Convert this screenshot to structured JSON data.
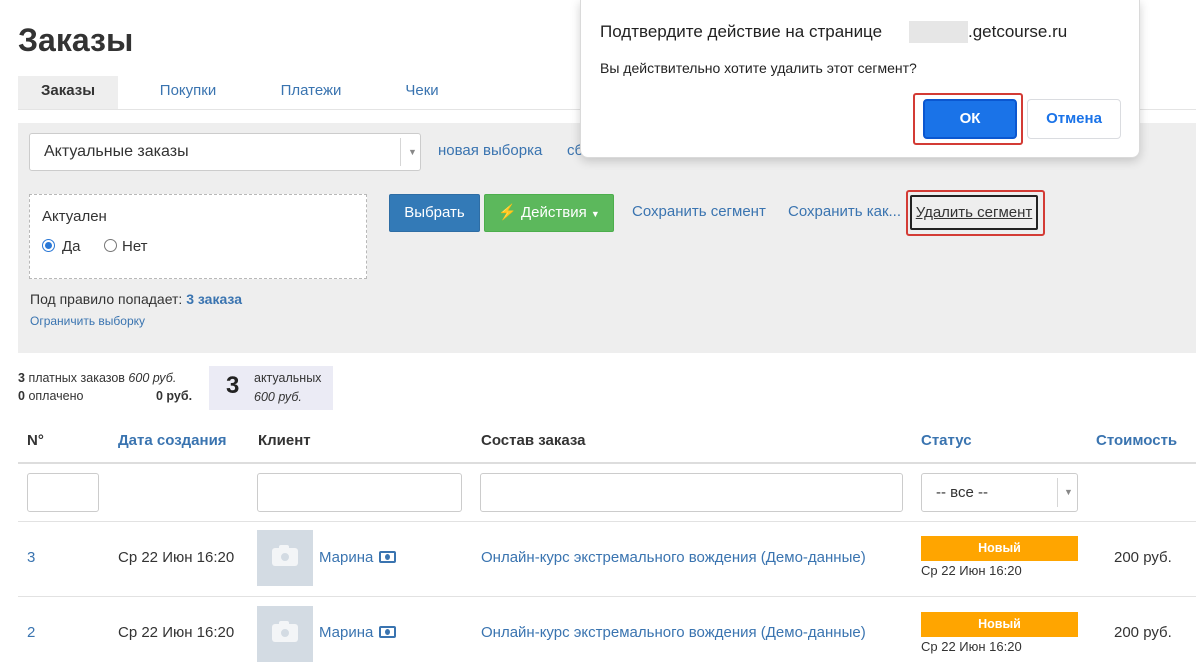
{
  "page": {
    "title": "Заказы"
  },
  "tabs": [
    {
      "label": "Заказы",
      "active": true
    },
    {
      "label": "Покупки"
    },
    {
      "label": "Платежи"
    },
    {
      "label": "Чеки"
    }
  ],
  "filter": {
    "segment_select": "Актуальные заказы",
    "new_selection_link": "новая выборка",
    "truncated_link": "сб",
    "segment_title": "Актуален",
    "radio_yes": "Да",
    "radio_no": "Нет",
    "radio_selected": "Да",
    "select_button": "Выбрать",
    "actions_button": "Действия",
    "save_segment": "Сохранить сегмент",
    "save_as": "Сохранить как...",
    "delete_segment": "Удалить сегмент",
    "rule_prefix": "Под правило попадает:",
    "rule_count": "3 заказа",
    "limit_link": "Ограничить выборку"
  },
  "stats": {
    "paid_count": "3",
    "paid_label": "платных заказов",
    "paid_sum": "600 руб.",
    "payed_count": "0",
    "payed_label": "оплачено",
    "payed_sum": "0 руб.",
    "actual_count": "3",
    "actual_label": "актуальных",
    "actual_sum": "600 руб."
  },
  "table": {
    "headers": [
      "N°",
      "Дата создания",
      "Клиент",
      "Состав заказа",
      "Статус",
      "Стоимость"
    ],
    "status_filter": "-- все --",
    "rows": [
      {
        "id": "3",
        "date": "Ср 22 Июн 16:20",
        "client": "Марина",
        "order": "Онлайн-курс экстремального вождения (Демо-данные)",
        "status": "Новый",
        "status_date": "Ср 22 Июн 16:20",
        "cost": "200 руб."
      },
      {
        "id": "2",
        "date": "Ср 22 Июн 16:20",
        "client": "Марина",
        "order": "Онлайн-курс экстремального вождения (Демо-данные)",
        "status": "Новый",
        "status_date": "Ср 22 Июн 16:20",
        "cost": "200 руб."
      }
    ]
  },
  "dialog": {
    "title_prefix": "Подтвердите действие на странице",
    "domain": ".getcourse.ru",
    "message": "Вы действительно хотите удалить этот сегмент?",
    "ok": "ОК",
    "cancel": "Отмена"
  },
  "colors": {
    "link": "#3a74b0",
    "status_new": "#ffa500",
    "btn_primary": "#337ab7",
    "btn_success": "#5cb85c",
    "dialog_ok": "#1a73e8",
    "highlight": "#d33b35"
  }
}
